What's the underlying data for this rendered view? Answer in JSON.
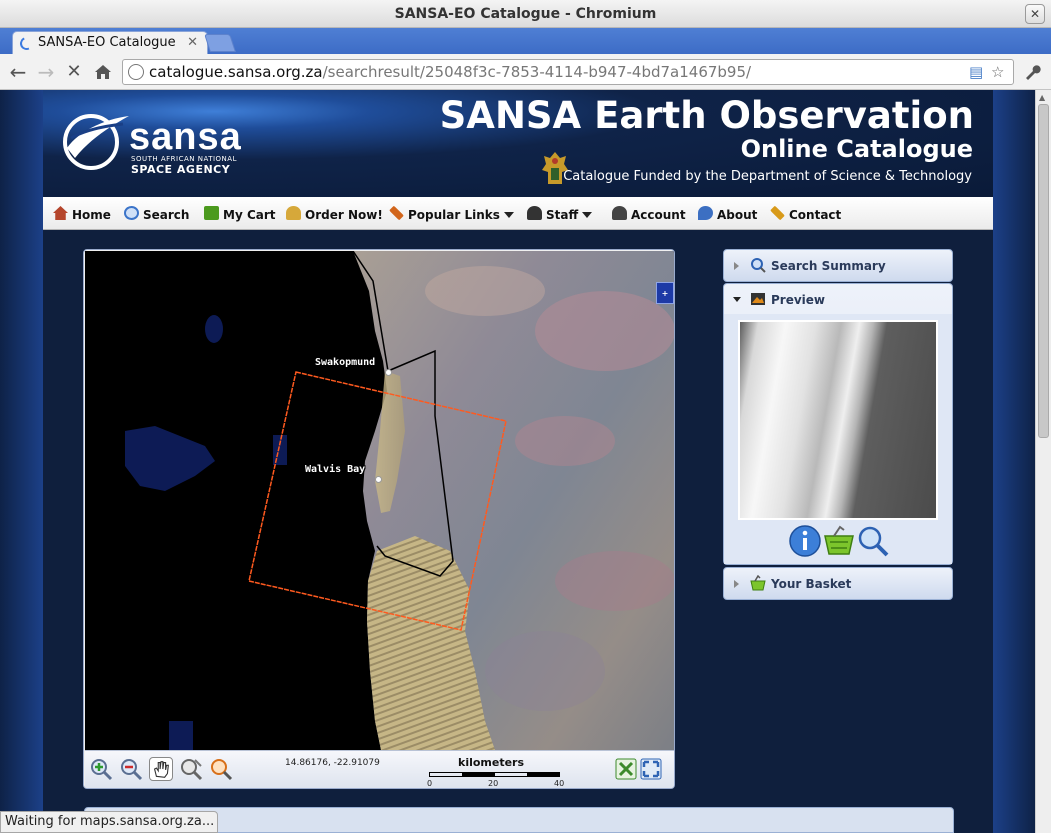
{
  "window": {
    "title": "SANSA-EO Catalogue - Chromium"
  },
  "tab": {
    "label": "SANSA-EO Catalogue"
  },
  "address_bar": {
    "domain": "catalogue.sansa.org.za",
    "path": "/searchresult/25048f3c-7853-4114-b947-4bd7a1467b95/"
  },
  "logo": {
    "word": "sansa",
    "sub1": "SOUTH AFRICAN NATIONAL",
    "sub2": "SPACE AGENCY"
  },
  "header": {
    "title": "SANSA Earth Observation",
    "subtitle": "Online Catalogue",
    "funding": "Catalogue Funded by the Department of Science & Technology"
  },
  "menu": {
    "items": [
      {
        "label": "Home",
        "icon": "house-icon",
        "color": "#b5452b"
      },
      {
        "label": "Search",
        "icon": "magnifier-icon",
        "color": "#3b74c9"
      },
      {
        "label": "My Cart",
        "icon": "basket-icon",
        "color": "#4c9a1e"
      },
      {
        "label": "Order Now!",
        "icon": "order-icon",
        "color": "#d6a83a"
      },
      {
        "label": "Popular Links",
        "icon": "pencil-icon",
        "color": "#d2661c"
      },
      {
        "label": "Staff",
        "icon": "people-icon",
        "color": "#333333"
      },
      {
        "label": "Account",
        "icon": "user-icon",
        "color": "#444444"
      },
      {
        "label": "About",
        "icon": "pin-icon",
        "color": "#3c6fc2"
      },
      {
        "label": "Contact",
        "icon": "pencil-icon",
        "color": "#d89a1a"
      }
    ]
  },
  "map": {
    "labels": {
      "town1": "Swakopmund",
      "town2": "Walvis Bay"
    },
    "coordinates": "14.86176, -22.91079",
    "scale": {
      "title": "kilometers",
      "ticks": [
        "0",
        "20",
        "40"
      ]
    }
  },
  "sidebar": {
    "search_summary": "Search Summary",
    "preview": "Preview",
    "your_basket": "Your Basket"
  },
  "status": {
    "text": "Waiting for maps.sansa.org.za..."
  },
  "colors": {
    "accent": "#1f4d9a",
    "footprint": "#ff5a1f",
    "chrome_tab": "#3d6cc6"
  }
}
